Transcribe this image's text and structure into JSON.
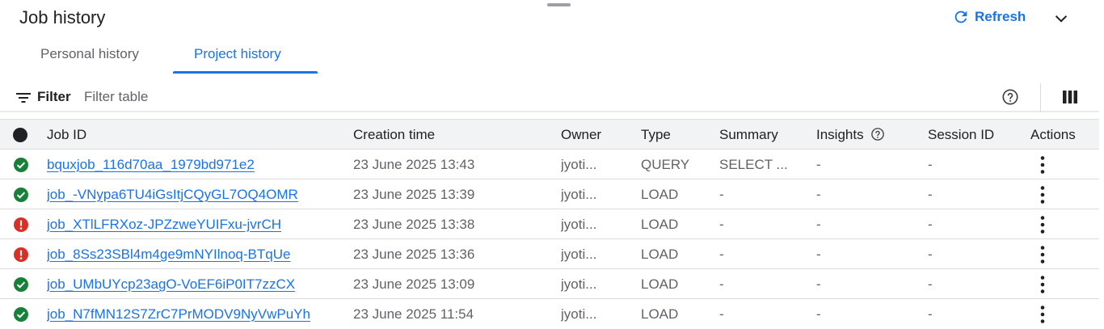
{
  "header": {
    "title": "Job history",
    "refresh_label": "Refresh"
  },
  "tabs": [
    {
      "label": "Personal history",
      "active": false
    },
    {
      "label": "Project history",
      "active": true
    }
  ],
  "toolbar": {
    "filter_label": "Filter",
    "filter_placeholder": "Filter table"
  },
  "columns": {
    "job_id": "Job ID",
    "creation_time": "Creation time",
    "owner": "Owner",
    "type": "Type",
    "summary": "Summary",
    "insights": "Insights",
    "session_id": "Session ID",
    "actions": "Actions"
  },
  "rows": [
    {
      "status": "success",
      "job_id": "bquxjob_116d70aa_1979bd971e2",
      "creation_time": "23 June 2025 13:43",
      "owner": "jyoti...",
      "type": "QUERY",
      "summary": "SELECT ...",
      "insights": "-",
      "session_id": "-"
    },
    {
      "status": "success",
      "job_id": "job_-VNypa6TU4iGsItjCQyGL7OQ4OMR",
      "creation_time": "23 June 2025 13:39",
      "owner": "jyoti...",
      "type": "LOAD",
      "summary": "-",
      "insights": "-",
      "session_id": "-"
    },
    {
      "status": "error",
      "job_id": "job_XTlLFRXoz-JPZzweYUIFxu-jvrCH",
      "creation_time": "23 June 2025 13:38",
      "owner": "jyoti...",
      "type": "LOAD",
      "summary": "-",
      "insights": "-",
      "session_id": "-"
    },
    {
      "status": "error",
      "job_id": "job_8Ss23SBl4m4ge9mNYIlnoq-BTqUe",
      "creation_time": "23 June 2025 13:36",
      "owner": "jyoti...",
      "type": "LOAD",
      "summary": "-",
      "insights": "-",
      "session_id": "-"
    },
    {
      "status": "success",
      "job_id": "job_UMbUYcp23agO-VoEF6iP0IT7zzCX",
      "creation_time": "23 June 2025 13:09",
      "owner": "jyoti...",
      "type": "LOAD",
      "summary": "-",
      "insights": "-",
      "session_id": "-"
    },
    {
      "status": "success",
      "job_id": "job_N7fMN12S7ZrC7PrMODV9NyVwPuYh",
      "creation_time": "23 June 2025 11:54",
      "owner": "jyoti...",
      "type": "LOAD",
      "summary": "-",
      "insights": "-",
      "session_id": "-"
    }
  ],
  "colors": {
    "accent": "#1a73e8",
    "success": "#188038",
    "error": "#d93025"
  },
  "icons": {
    "refresh": "refresh-icon",
    "collapse": "chevron-down-icon",
    "filter": "filter-icon",
    "help": "help-icon",
    "columns": "column-display-icon",
    "success": "check-circle-icon",
    "error": "error-icon",
    "actions": "more-vert-icon"
  }
}
